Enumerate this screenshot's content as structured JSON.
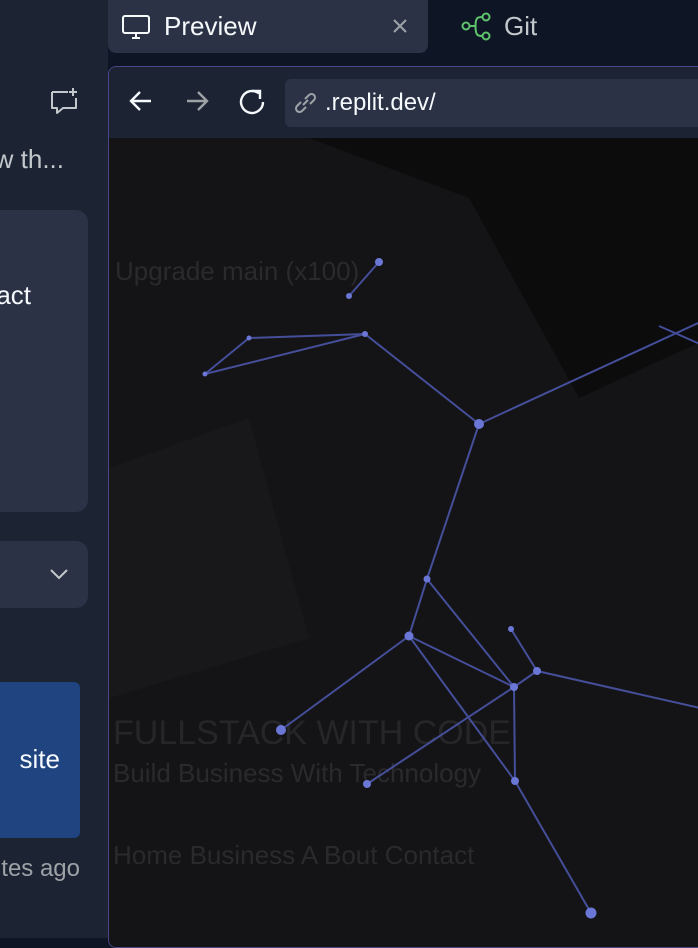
{
  "sidebar": {
    "chat_title": "w th...",
    "card_text": "act",
    "action_label": "site",
    "timestamp": "utes ago"
  },
  "tabs": {
    "preview_label": "Preview",
    "git_label": "Git"
  },
  "browser": {
    "url": ".replit.dev/"
  },
  "webview": {
    "ghost_line_1": "Upgrade main (x100)",
    "ghost_heading": "FULLSTACK WITH CODE",
    "ghost_subtitle": "Build Business With Technology",
    "ghost_nav": "Home  Business  A Bout  Contact"
  },
  "colors": {
    "accent_blue": "#1f4480",
    "git_green": "#5fc36e",
    "network_line": "#4a55a8"
  }
}
